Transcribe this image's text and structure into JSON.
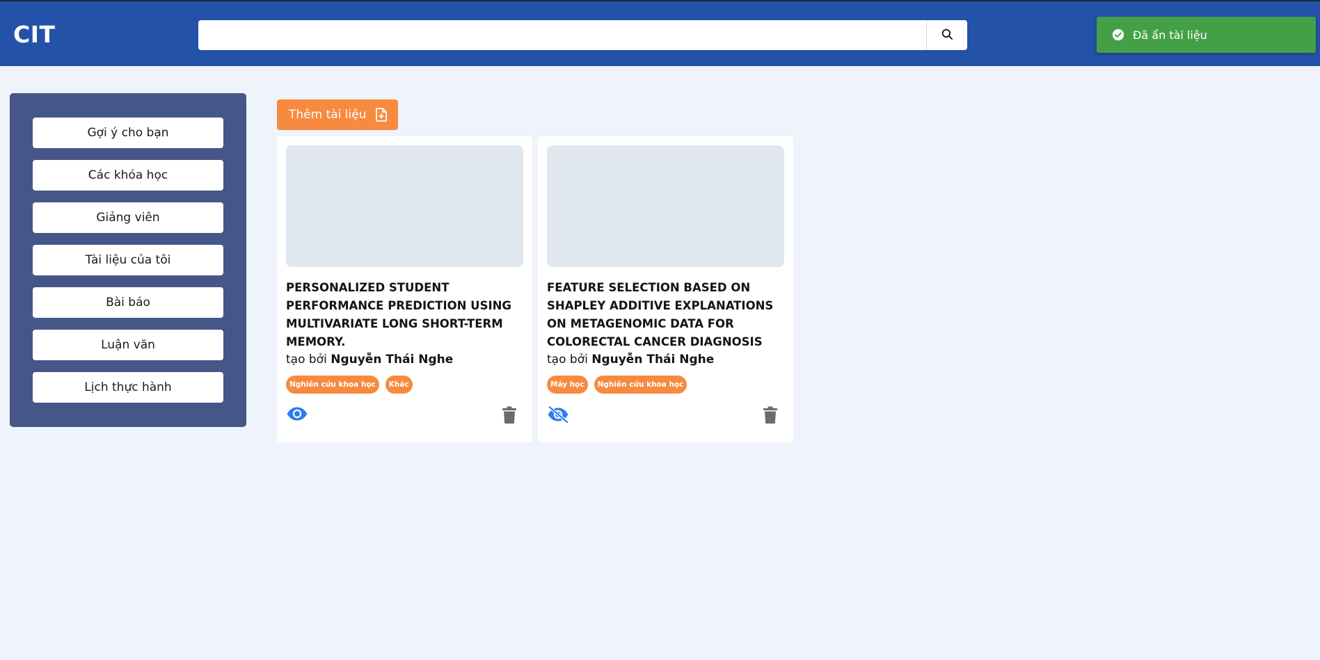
{
  "header": {
    "logo": "CIT",
    "search": {
      "value": "",
      "placeholder": ""
    }
  },
  "toast": {
    "message": "Đã ẩn tài liệu",
    "color": "#43a047"
  },
  "sidebar": {
    "items": [
      {
        "label": "Gợi ý cho bạn"
      },
      {
        "label": "Các khóa học"
      },
      {
        "label": "Giảng viên"
      },
      {
        "label": "Tài liệu của tôi"
      },
      {
        "label": "Bài báo"
      },
      {
        "label": "Luận văn"
      },
      {
        "label": "Lịch thực hành"
      }
    ]
  },
  "main": {
    "add_button": {
      "label": "Thêm tài liệu",
      "icon": "file-plus-icon"
    },
    "documents": [
      {
        "title": "PERSONALIZED STUDENT PERFORMANCE PREDICTION USING MULTIVARIATE LONG SHORT-TERM MEMORY.",
        "author_prefix": "tạo bởi",
        "author": "Nguyễn Thái Nghe",
        "tags": [
          "Nghiên cứu khoa học",
          "Khác"
        ],
        "visibility_icon": "eye-icon",
        "delete_icon": "trash-icon"
      },
      {
        "title": "FEATURE SELECTION BASED ON SHAPLEY ADDITIVE EXPLANATIONS ON METAGENOMIC DATA FOR COLORECTAL CANCER DIAGNOSIS",
        "author_prefix": "tạo bởi",
        "author": "Nguyễn Thái Nghe",
        "tags": [
          "Máy học",
          "Nghiên cứu khoa học"
        ],
        "visibility_icon": "eye-slash-icon",
        "delete_icon": "trash-icon"
      }
    ]
  },
  "colors": {
    "header": "#2352a8",
    "sidebar": "#465688",
    "accent": "#f68b3f",
    "eye": "#2f7bf0",
    "background": "#eff3fc"
  }
}
